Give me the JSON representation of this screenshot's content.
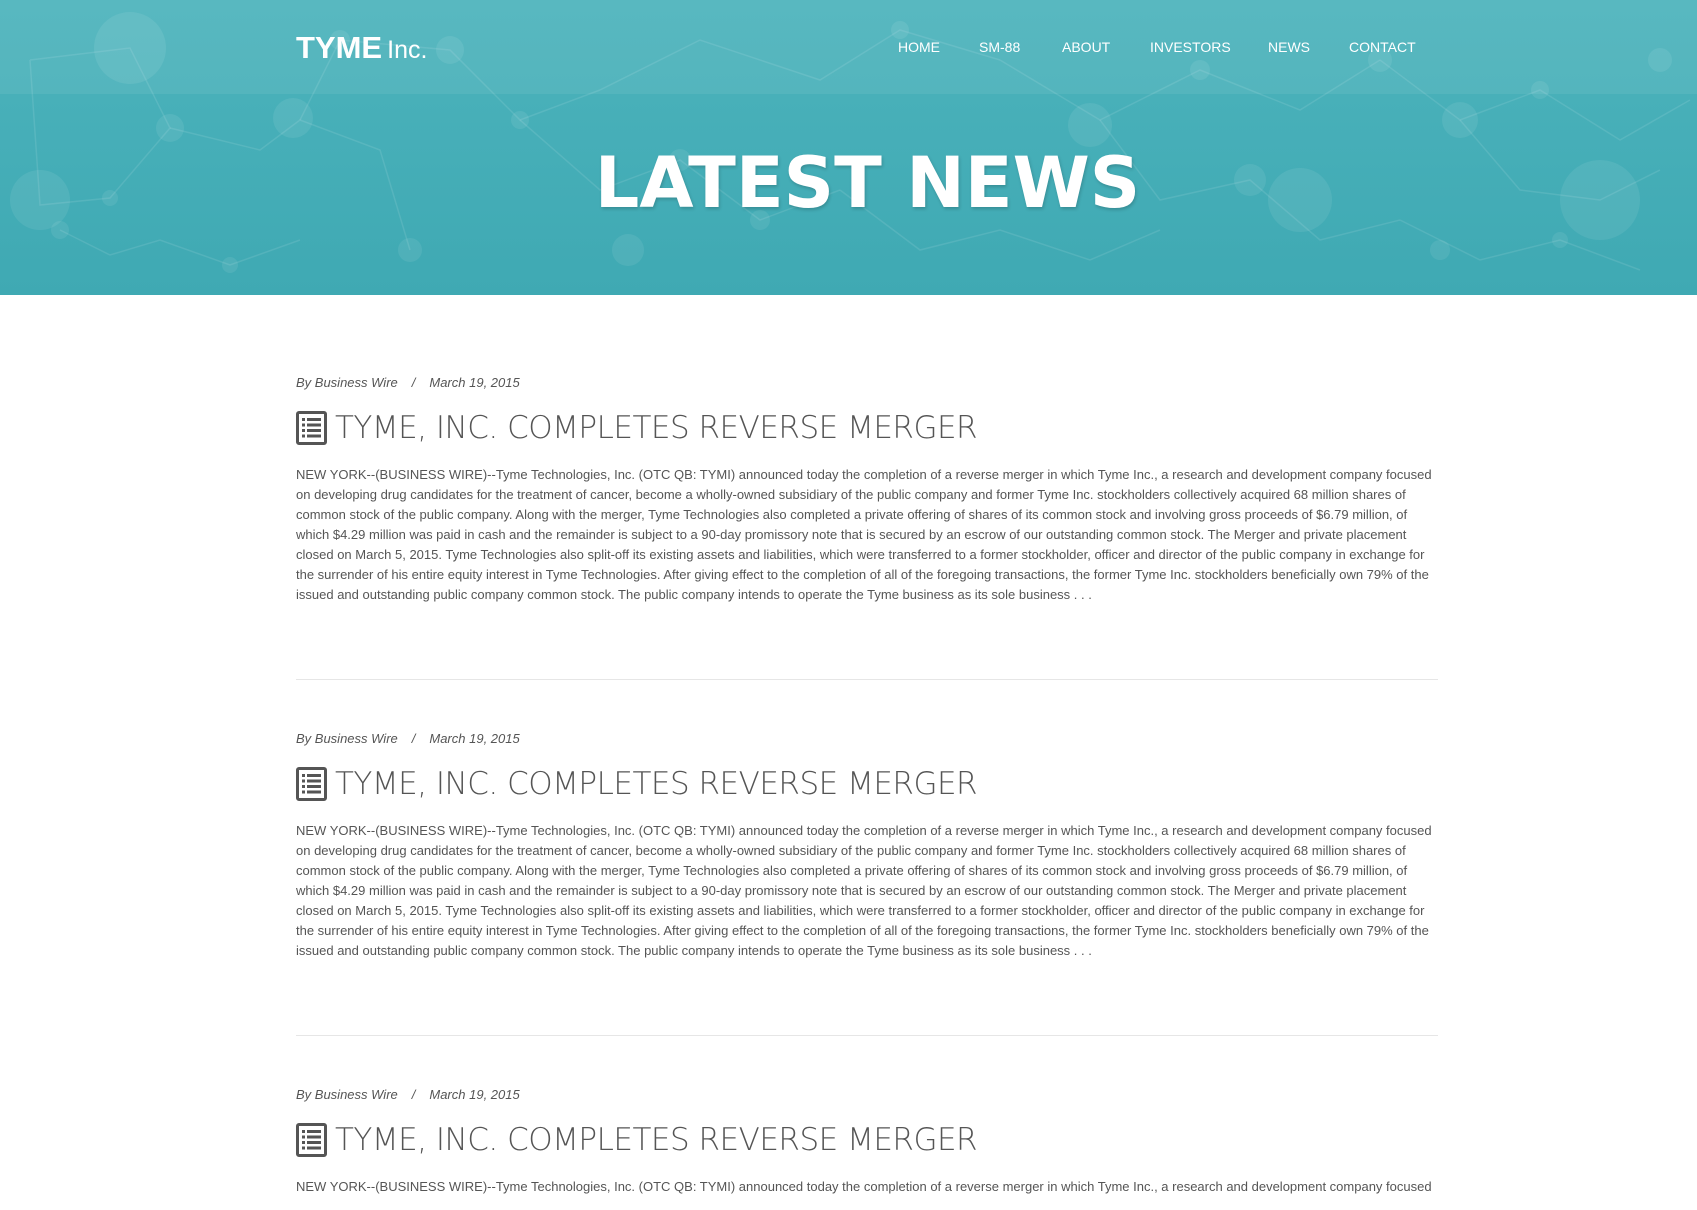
{
  "header": {
    "logo_brand": "TYME",
    "logo_suffix": "Inc.",
    "nav": [
      {
        "label": "HOME"
      },
      {
        "label": "SM-88"
      },
      {
        "label": "ABOUT"
      },
      {
        "label": "INVESTORS"
      },
      {
        "label": "NEWS"
      },
      {
        "label": "CONTACT"
      }
    ]
  },
  "hero": {
    "title": "LATEST NEWS"
  },
  "posts": [
    {
      "author": "By Business Wire",
      "separator": "/",
      "date": "March 19, 2015",
      "title": "TYME, INC. COMPLETES REVERSE MERGER",
      "excerpt": "NEW YORK--(BUSINESS WIRE)--Tyme Technologies, Inc. (OTC QB: TYMI) announced today the completion of a reverse merger in which Tyme Inc., a research and development company focused on developing drug candidates for the treatment of cancer, become a wholly-owned subsidiary of the public company and former Tyme Inc. stockholders collectively acquired 68 million shares of common stock of the public company. Along with the merger, Tyme Technologies also completed a private offering of shares of its common stock and involving gross proceeds of $6.79 million, of which $4.29 million was paid in cash and the remainder is subject to a 90-day promissory note that is secured by an escrow of our outstanding common stock. The Merger and private placement closed on March 5, 2015. Tyme Technologies also split-off its existing assets and liabilities, which were transferred to a former stockholder, officer and director of the public company in exchange for the surrender of his entire equity interest in Tyme Technologies. After giving effect to the completion of all of the foregoing transactions, the former Tyme Inc. stockholders beneficially own 79% of the issued and outstanding public company common stock. The public company intends to operate the Tyme business as its sole business . . ."
    },
    {
      "author": "By Business Wire",
      "separator": "/",
      "date": "March 19, 2015",
      "title": "TYME, INC. COMPLETES REVERSE MERGER",
      "excerpt": "NEW YORK--(BUSINESS WIRE)--Tyme Technologies, Inc. (OTC QB: TYMI) announced today the completion of a reverse merger in which Tyme Inc., a research and development company focused on developing drug candidates for the treatment of cancer, become a wholly-owned subsidiary of the public company and former Tyme Inc. stockholders collectively acquired 68 million shares of common stock of the public company. Along with the merger, Tyme Technologies also completed a private offering of shares of its common stock and involving gross proceeds of $6.79 million, of which $4.29 million was paid in cash and the remainder is subject to a 90-day promissory note that is secured by an escrow of our outstanding common stock. The Merger and private placement closed on March 5, 2015. Tyme Technologies also split-off its existing assets and liabilities, which were transferred to a former stockholder, officer and director of the public company in exchange for the surrender of his entire equity interest in Tyme Technologies. After giving effect to the completion of all of the foregoing transactions, the former Tyme Inc. stockholders beneficially own 79% of the issued and outstanding public company common stock. The public company intends to operate the Tyme business as its sole business . . ."
    },
    {
      "author": "By Business Wire",
      "separator": "/",
      "date": "March 19, 2015",
      "title": "TYME, INC. COMPLETES REVERSE MERGER",
      "excerpt": "NEW YORK--(BUSINESS WIRE)--Tyme Technologies, Inc. (OTC QB: TYMI) announced today the completion of a reverse merger in which Tyme Inc., a research and development company focused"
    }
  ],
  "colors": {
    "hero": "#45adb6",
    "text": "#555555",
    "divider": "#e6e6e6"
  },
  "icons": {
    "post": "document-list-icon"
  }
}
